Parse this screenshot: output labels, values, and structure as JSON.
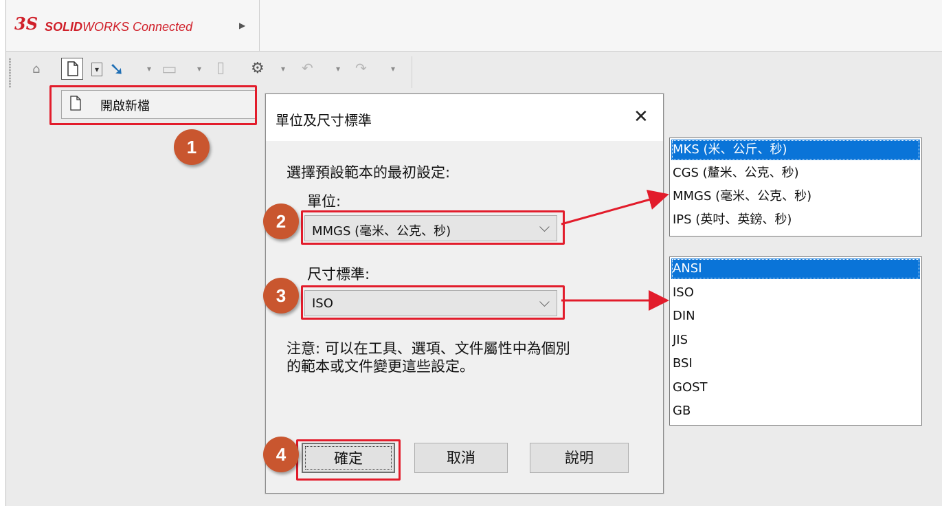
{
  "app": {
    "logo_mark": "3S",
    "brand_bold": "SOLID",
    "brand_rest": "WORKS Connected"
  },
  "toolbar": {
    "icons": [
      "home-icon",
      "new-document-icon",
      "dropdown-icon",
      "open-arrow-icon",
      "dropdown-icon",
      "save-icon",
      "dropdown-icon",
      "print-icon",
      "gear-icon",
      "dropdown-icon",
      "undo-icon",
      "dropdown-icon",
      "redo-icon",
      "dropdown-icon"
    ]
  },
  "popup": {
    "new_doc_label": "開啟新檔"
  },
  "badges": [
    "1",
    "2",
    "3",
    "4"
  ],
  "dialog": {
    "title": "單位及尺寸標準",
    "close_glyph": "✕",
    "intro": "選擇預設範本的最初設定:",
    "units_label": "單位:",
    "units_value": "MMGS (毫米、公克、秒)",
    "dimstd_label": "尺寸標準:",
    "dimstd_value": "ISO",
    "note_line1": "注意: 可以在工具、選項、文件屬性中為個別",
    "note_line2": "的範本或文件變更這些設定。",
    "ok_label": "確定",
    "cancel_label": "取消",
    "help_label": "說明"
  },
  "units_options": [
    "MKS  (米、公斤、秒)",
    "CGS  (釐米、公克、秒)",
    "MMGS (毫米、公克、秒)",
    "IPS  (英吋、英鎊、秒)"
  ],
  "units_selected_index": 0,
  "dimstd_options": [
    "ANSI",
    "ISO",
    "DIN",
    "JIS",
    "BSI",
    "GOST",
    "GB"
  ],
  "dimstd_selected_index": 0,
  "colors": {
    "highlight": "#e21c2b",
    "badge": "#c9562f",
    "selection": "#0a74d8",
    "brand": "#d0202a"
  }
}
